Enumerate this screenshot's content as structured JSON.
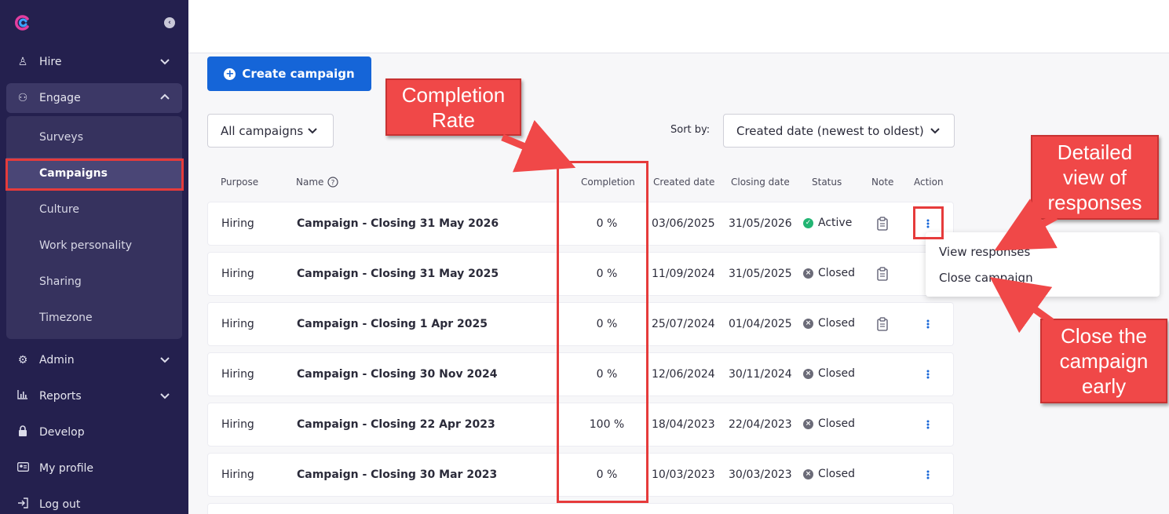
{
  "sidebar": {
    "items": [
      {
        "label": "Hire",
        "icon": "person-icon"
      },
      {
        "label": "Engage",
        "icon": "people-icon"
      },
      {
        "label": "Admin",
        "icon": "gear-icon"
      },
      {
        "label": "Reports",
        "icon": "bar-chart-icon"
      },
      {
        "label": "Develop",
        "icon": "lock-icon"
      },
      {
        "label": "My profile",
        "icon": "profile-card-icon"
      },
      {
        "label": "Log out",
        "icon": "logout-icon"
      }
    ],
    "engage_submenu": [
      "Surveys",
      "Campaigns",
      "Culture",
      "Work personality",
      "Sharing",
      "Timezone"
    ]
  },
  "toolbar": {
    "create_label": "Create campaign",
    "filter_label": "All campaigns",
    "sort_prefix": "Sort by:",
    "sort_value": "Created date (newest to oldest)"
  },
  "table": {
    "headers": {
      "purpose": "Purpose",
      "name": "Name",
      "completion": "Completion",
      "created": "Created date",
      "closing": "Closing date",
      "status": "Status",
      "note": "Note",
      "action": "Action"
    },
    "rows": [
      {
        "purpose": "Hiring",
        "name": "Campaign - Closing 31 May 2026",
        "completion": "0 %",
        "created": "03/06/2025",
        "closing": "31/05/2026",
        "status": "Active"
      },
      {
        "purpose": "Hiring",
        "name": "Campaign - Closing 31 May 2025",
        "completion": "0 %",
        "created": "11/09/2024",
        "closing": "31/05/2025",
        "status": "Closed"
      },
      {
        "purpose": "Hiring",
        "name": "Campaign - Closing 1 Apr 2025",
        "completion": "0 %",
        "created": "25/07/2024",
        "closing": "01/04/2025",
        "status": "Closed"
      },
      {
        "purpose": "Hiring",
        "name": "Campaign - Closing 30 Nov 2024",
        "completion": "0 %",
        "created": "12/06/2024",
        "closing": "30/11/2024",
        "status": "Closed"
      },
      {
        "purpose": "Hiring",
        "name": "Campaign - Closing 22 Apr 2023",
        "completion": "100 %",
        "created": "18/04/2023",
        "closing": "22/04/2023",
        "status": "Closed"
      },
      {
        "purpose": "Hiring",
        "name": "Campaign - Closing 30 Mar 2023",
        "completion": "0 %",
        "created": "10/03/2023",
        "closing": "30/03/2023",
        "status": "Closed"
      }
    ]
  },
  "action_menu": {
    "items": [
      "View responses",
      "Close campaign"
    ]
  },
  "annotations": {
    "completion": "Completion Rate",
    "detailed": "Detailed view of responses",
    "close": "Close the campaign early"
  },
  "colors": {
    "sidebar": "#24204e",
    "primary": "#1565d8",
    "annotation": "#f04848",
    "active_status": "#22b573"
  }
}
